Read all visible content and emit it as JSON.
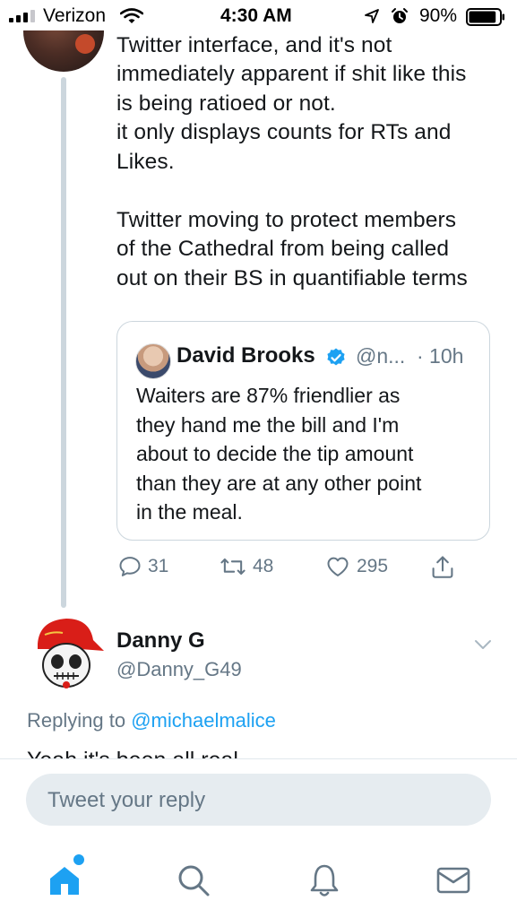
{
  "status_bar": {
    "carrier": "Verizon",
    "time": "4:30 AM",
    "battery_percent": "90%",
    "battery_level": 0.9
  },
  "tweet": {
    "text": "I've been switched to the new\nTwitter interface, and it's not\nimmediately apparent if shit like this\nis being ratioed or not.\nit only displays counts for RTs and\nLikes.\n\nTwitter moving to protect members\nof the Cathedral from being called\nout on their BS in quantifiable terms"
  },
  "quoted_tweet": {
    "name": "David Brooks",
    "handle": "@n...",
    "time": "· 10h",
    "text": "Waiters are 87% friendlier as\nthey hand me the bill and I'm\nabout to decide the tip amount\nthan they are at any other point\nin the meal."
  },
  "actions": {
    "replies": "31",
    "retweets": "48",
    "likes": "295"
  },
  "reply": {
    "name": "Danny G",
    "handle": "@Danny_G49",
    "replying_prefix": "Replying to ",
    "replying_to": "@michaelmalice",
    "cut_text": "Yeah it's been all real"
  },
  "composer": {
    "placeholder": "Tweet your reply"
  },
  "colors": {
    "accent": "#1da1f2",
    "secondary_text": "#657786",
    "border": "#ccd6dd"
  },
  "tabs": [
    {
      "icon": "home-icon"
    },
    {
      "icon": "search-icon"
    },
    {
      "icon": "bell-icon"
    },
    {
      "icon": "mail-icon"
    }
  ]
}
